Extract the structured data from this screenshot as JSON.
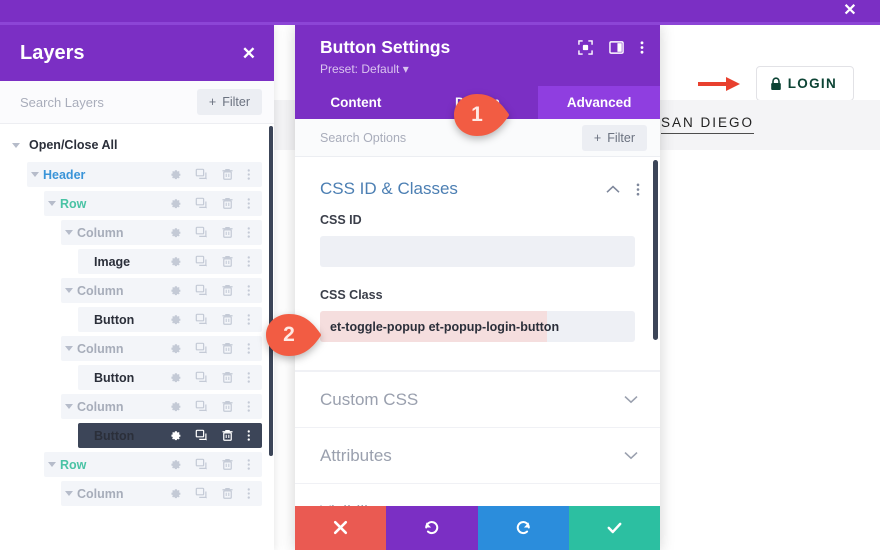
{
  "topbar": {
    "close_label": "✕"
  },
  "site": {
    "login_label": "LOGIN",
    "lock_icon": "lock-icon",
    "arrow_icon": "red-arrow-icon",
    "nav_item": "SAN DIEGO"
  },
  "layers": {
    "title": "Layers",
    "close_label": "✕",
    "search_placeholder": "Search Layers",
    "filter_label": "Filter",
    "filter_plus": "+",
    "open_close_all": "Open/Close All",
    "row_icons": [
      "gear-icon",
      "duplicate-icon",
      "trash-icon",
      "more-vertical-icon"
    ],
    "items": [
      {
        "label": "Header",
        "indent": 1,
        "kind": "module",
        "color": "#3a94d8",
        "caret": true,
        "selected": false
      },
      {
        "label": "Row",
        "indent": 2,
        "kind": "row",
        "color": "#4ac3a5",
        "caret": true,
        "selected": false
      },
      {
        "label": "Column",
        "indent": 3,
        "kind": "column",
        "color": "#a7adba",
        "caret": true,
        "selected": false
      },
      {
        "label": "Image",
        "indent": 4,
        "kind": "item",
        "color": "#2b2f3a",
        "caret": false,
        "selected": false
      },
      {
        "label": "Column",
        "indent": 3,
        "kind": "column",
        "color": "#a7adba",
        "caret": true,
        "selected": false
      },
      {
        "label": "Button",
        "indent": 4,
        "kind": "item",
        "color": "#2b2f3a",
        "caret": false,
        "selected": false
      },
      {
        "label": "Column",
        "indent": 3,
        "kind": "column",
        "color": "#a7adba",
        "caret": true,
        "selected": false
      },
      {
        "label": "Button",
        "indent": 4,
        "kind": "item",
        "color": "#2b2f3a",
        "caret": false,
        "selected": false
      },
      {
        "label": "Column",
        "indent": 3,
        "kind": "column",
        "color": "#a7adba",
        "caret": true,
        "selected": false
      },
      {
        "label": "Button",
        "indent": 4,
        "kind": "item",
        "color": "#2b2f3a",
        "caret": false,
        "selected": true
      },
      {
        "label": "Row",
        "indent": 2,
        "kind": "row",
        "color": "#4ac3a5",
        "caret": true,
        "selected": false
      },
      {
        "label": "Column",
        "indent": 3,
        "kind": "column",
        "color": "#a7adba",
        "caret": true,
        "selected": false
      }
    ]
  },
  "settings": {
    "title": "Button Settings",
    "preset": "Preset: Default",
    "preset_caret": "▾",
    "head_icons": [
      "focus-icon",
      "split-view-icon",
      "more-vertical-icon"
    ],
    "tabs": [
      {
        "label": "Content",
        "active": false
      },
      {
        "label": "Design",
        "active": false
      },
      {
        "label": "Advanced",
        "active": true
      }
    ],
    "search_placeholder": "Search Options",
    "filter_label": "Filter",
    "filter_plus": "+",
    "open_section": {
      "title": "CSS ID & Classes",
      "collapse_icon": "chevron-up-icon",
      "more_icon": "more-vertical-icon",
      "fields": [
        {
          "label": "CSS ID",
          "value": "",
          "placeholder": ""
        },
        {
          "label": "CSS Class",
          "value": "et-toggle-popup et-popup-login-button",
          "placeholder": ""
        }
      ]
    },
    "closed_sections": [
      {
        "title": "Custom CSS",
        "icon": "chevron-down-icon"
      },
      {
        "title": "Attributes",
        "icon": "chevron-down-icon"
      },
      {
        "title": "Visibility",
        "icon": "chevron-down-icon"
      }
    ],
    "actions": [
      {
        "name": "discard-button",
        "icon": "close-icon",
        "color": "#ea5a52"
      },
      {
        "name": "undo-button",
        "icon": "undo-icon",
        "color": "#7b2fc4"
      },
      {
        "name": "redo-button",
        "icon": "redo-icon",
        "color": "#2b8ddc"
      },
      {
        "name": "save-button",
        "icon": "check-icon",
        "color": "#2cbfa1"
      }
    ]
  },
  "markers": [
    {
      "number": "1",
      "color": "#f25c43"
    },
    {
      "number": "2",
      "color": "#f25c43"
    }
  ]
}
